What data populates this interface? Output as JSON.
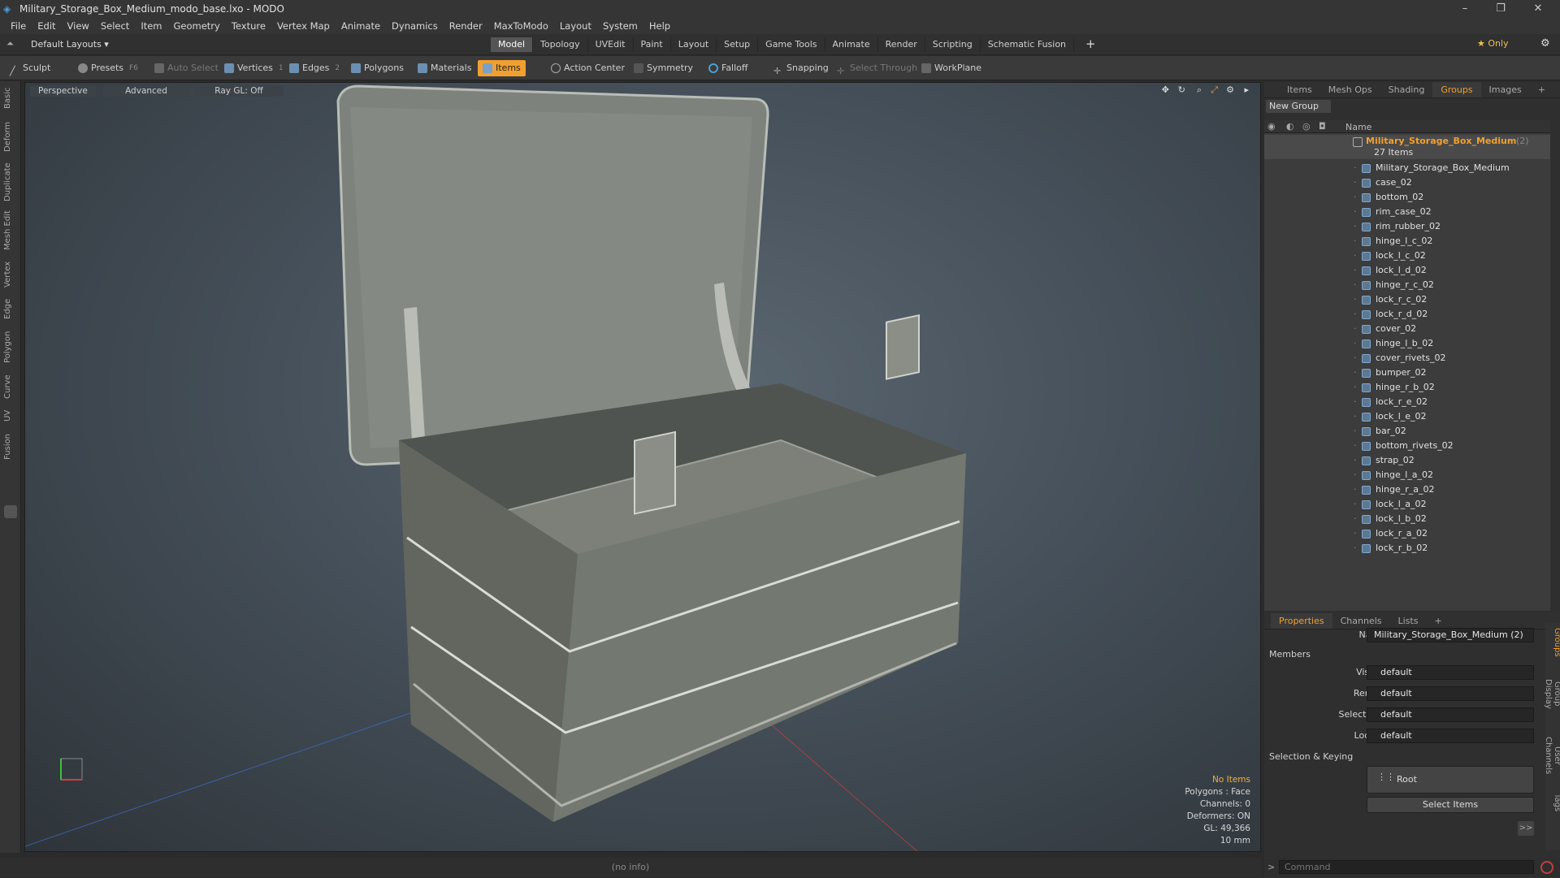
{
  "window": {
    "title": "Military_Storage_Box_Medium_modo_base.lxo - MODO",
    "controls": {
      "minimize": "–",
      "restore": "❐",
      "close": "✕"
    }
  },
  "menu": [
    "File",
    "Edit",
    "View",
    "Select",
    "Item",
    "Geometry",
    "Texture",
    "Vertex Map",
    "Animate",
    "Dynamics",
    "Render",
    "MaxToModo",
    "Layout",
    "System",
    "Help"
  ],
  "layoutbar": {
    "layouts_label": "Default Layouts ▾",
    "tabs": [
      "Model",
      "Topology",
      "UVEdit",
      "Paint",
      "Layout",
      "Setup",
      "Game Tools",
      "Animate",
      "Render",
      "Scripting",
      "Schematic Fusion"
    ],
    "active_tab": "Model",
    "add": "+",
    "only_label": "★ Only",
    "gear": "⚙"
  },
  "toolbar": {
    "sculpt": "Sculpt",
    "presets": "Presets",
    "presets_key": "F6",
    "auto_select": "Auto Select",
    "vertices": "Vertices",
    "vertices_count": "1",
    "edges": "Edges",
    "edges_count": "2",
    "polygons": "Polygons",
    "materials": "Materials",
    "items": "Items",
    "action_center": "Action Center",
    "symmetry": "Symmetry",
    "falloff": "Falloff",
    "snapping": "Snapping",
    "select_through": "Select Through",
    "workplane": "WorkPlane"
  },
  "left_tabs": [
    "Basic",
    "Deform",
    "Duplicate",
    "Mesh Edit",
    "Vertex",
    "Edge",
    "Polygon",
    "Curve",
    "UV",
    "Fusion"
  ],
  "viewport": {
    "view": "Perspective",
    "shading": "Advanced",
    "raygl": "Ray GL: Off",
    "hud": {
      "selection": "No Items",
      "polygons": "Polygons : Face",
      "channels": "Channels: 0",
      "deformers": "Deformers: ON",
      "gl": "GL: 49,366",
      "unit": "10 mm"
    }
  },
  "right_tabs": {
    "tabs": [
      "Items",
      "Mesh Ops",
      "Shading",
      "Groups",
      "Images"
    ],
    "active": "Groups",
    "add": "+"
  },
  "groups": {
    "new_group": "New Group",
    "name_header": "Name",
    "root_name": "Military_Storage_Box_Medium",
    "root_suffix": "(2)",
    "root_count": "27 Items",
    "items": [
      "Military_Storage_Box_Medium",
      "case_02",
      "bottom_02",
      "rim_case_02",
      "rim_rubber_02",
      "hinge_l_c_02",
      "lock_l_c_02",
      "lock_l_d_02",
      "hinge_r_c_02",
      "lock_r_c_02",
      "lock_r_d_02",
      "cover_02",
      "hinge_l_b_02",
      "cover_rivets_02",
      "bumper_02",
      "hinge_r_b_02",
      "lock_r_e_02",
      "lock_l_e_02",
      "bar_02",
      "bottom_rivets_02",
      "strap_02",
      "hinge_l_a_02",
      "hinge_r_a_02",
      "lock_l_a_02",
      "lock_l_b_02",
      "lock_r_a_02",
      "lock_r_b_02"
    ]
  },
  "props_tabs": {
    "tabs": [
      "Properties",
      "Channels",
      "Lists"
    ],
    "active": "Properties",
    "add": "+"
  },
  "properties": {
    "name_label": "Name",
    "name_value": "Military_Storage_Box_Medium (2)",
    "members": "Members",
    "visible_label": "Visible",
    "visible_value": "default",
    "render_label": "Render",
    "render_value": "default",
    "selectable_label": "Selectable",
    "selectable_value": "default",
    "locked_label": "Locked",
    "locked_value": "default",
    "selection_keying": "Selection & Keying",
    "root_button": "Root",
    "select_items": "Select Items",
    "more": ">>"
  },
  "side_tabs": [
    "Groups",
    "Group Display",
    "User Channels",
    "Tags"
  ],
  "status": {
    "info": "(no info)",
    "command_placeholder": "Command",
    "prompt": ">"
  },
  "colors": {
    "accent": "#f0a030",
    "group_name": "#f0a030"
  }
}
